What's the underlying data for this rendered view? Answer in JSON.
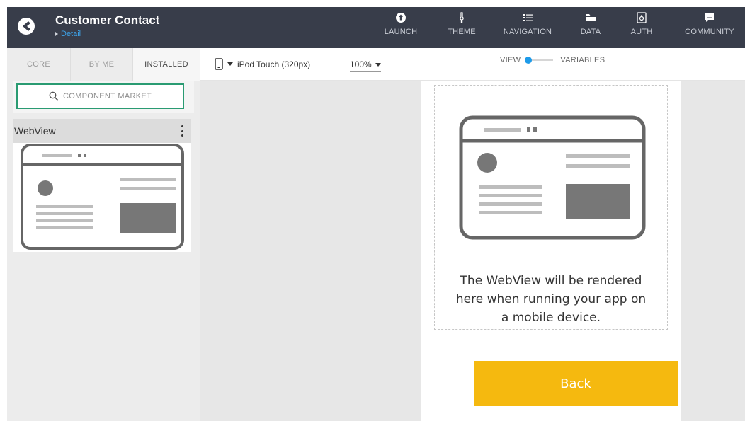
{
  "app": {
    "title": "Customer Contact",
    "breadcrumb": "Detail"
  },
  "nav": [
    {
      "label": "LAUNCH",
      "icon": "rocket-icon"
    },
    {
      "label": "THEME",
      "icon": "brush-icon"
    },
    {
      "label": "NAVIGATION",
      "icon": "list-icon"
    },
    {
      "label": "DATA",
      "icon": "folder-icon"
    },
    {
      "label": "AUTH",
      "icon": "key-icon"
    },
    {
      "label": "COMMUNITY",
      "icon": "chat-icon"
    }
  ],
  "left_panel": {
    "tabs": [
      "CORE",
      "BY ME",
      "INSTALLED"
    ],
    "active_tab": "INSTALLED",
    "search_placeholder": "COMPONENT MARKET",
    "component": {
      "name": "WebView"
    }
  },
  "toolbar": {
    "device": "iPod Touch (320px)",
    "zoom": "100%",
    "view_label": "VIEW",
    "variables_label": "VARIABLES"
  },
  "screen": {
    "webview_message": "The WebView will be rendered here when running your app on a mobile device.",
    "back_button": "Back"
  },
  "colors": {
    "topbar": "#383d4a",
    "accent_blue": "#1e9be9",
    "search_border": "#2a9b72",
    "back_button": "#f5b90f"
  }
}
